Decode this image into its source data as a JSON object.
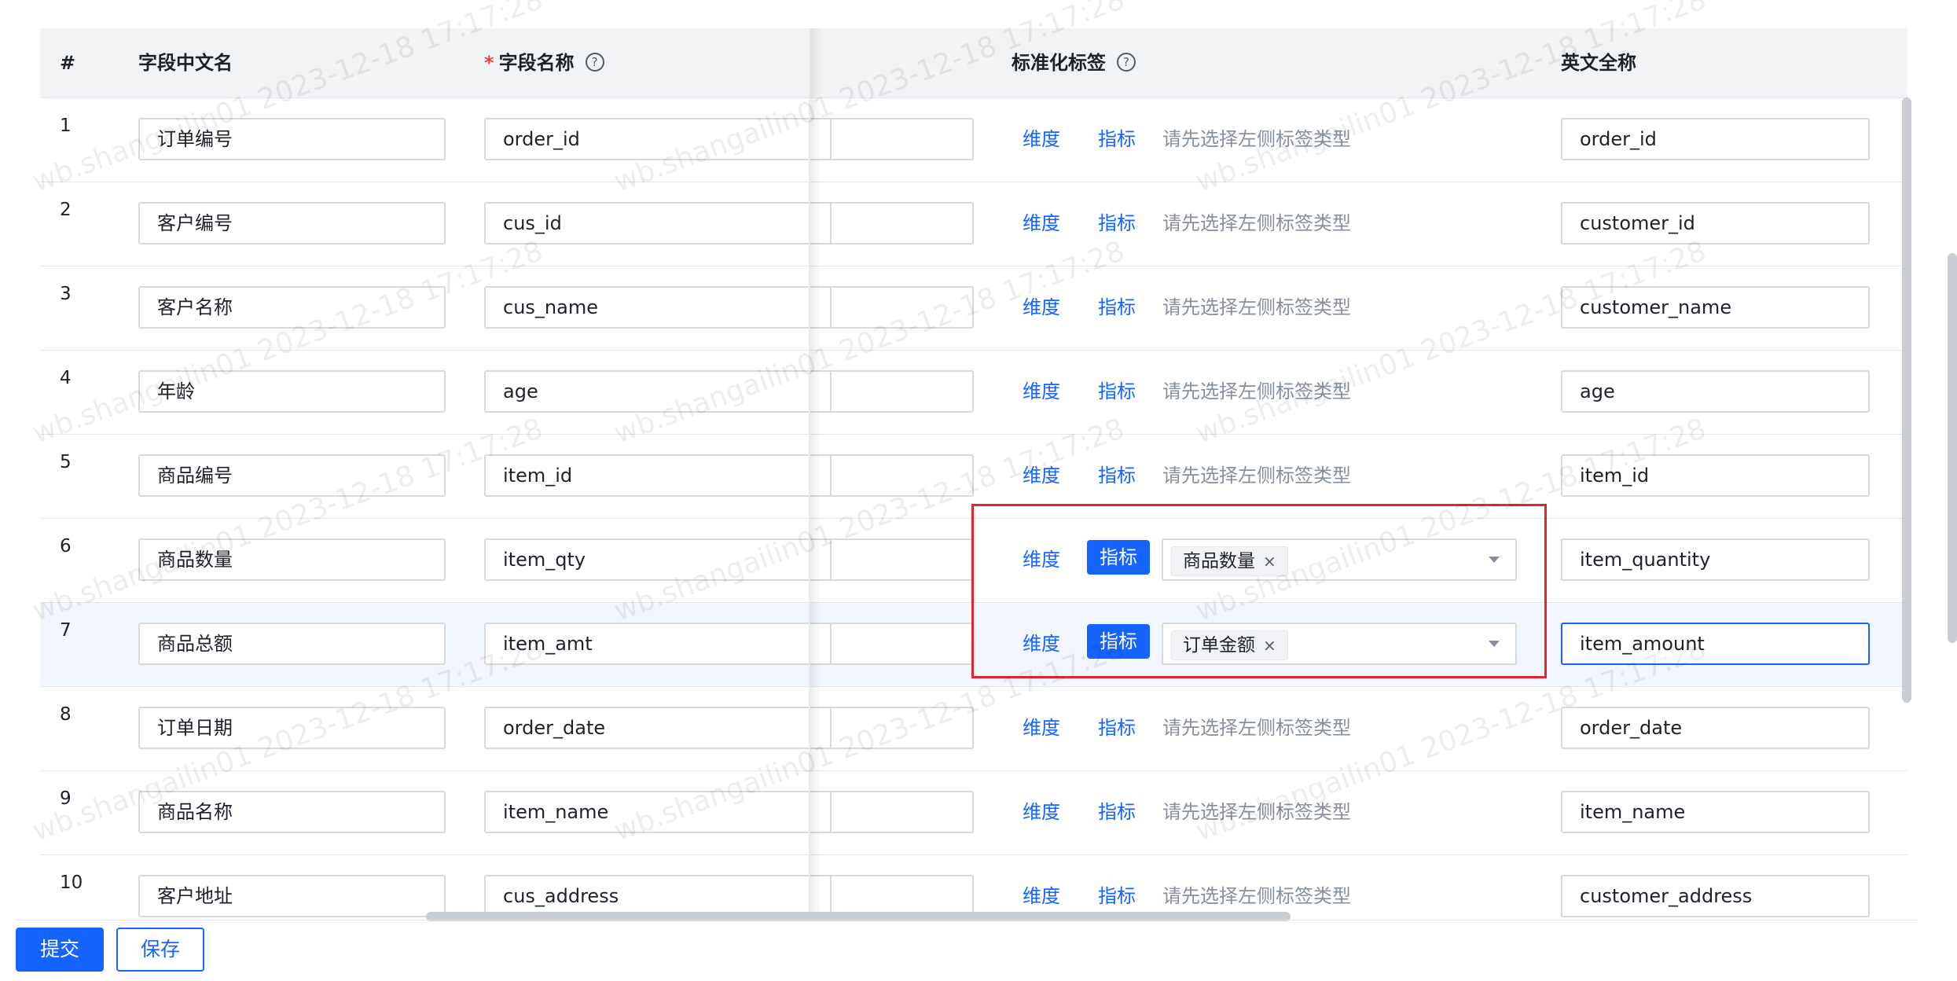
{
  "headers": {
    "num": "#",
    "cn_name": "字段中文名",
    "required_mark": "*",
    "field_name": "字段名称",
    "std_tag": "标准化标签",
    "en_full": "英文全称",
    "help_glyph": "?"
  },
  "tag_buttons": {
    "dimension": "维度",
    "indicator": "指标"
  },
  "tag_placeholder": "请先选择左侧标签类型",
  "rows": [
    {
      "num": "1",
      "cn": "订单编号",
      "en": "order_id",
      "full": "order_id"
    },
    {
      "num": "2",
      "cn": "客户编号",
      "en": "cus_id",
      "full": "customer_id"
    },
    {
      "num": "3",
      "cn": "客户名称",
      "en": "cus_name",
      "full": "customer_name"
    },
    {
      "num": "4",
      "cn": "年龄",
      "en": "age",
      "full": "age"
    },
    {
      "num": "5",
      "cn": "商品编号",
      "en": "item_id",
      "full": "item_id"
    },
    {
      "num": "6",
      "cn": "商品数量",
      "en": "item_qty",
      "full": "item_quantity",
      "tag": "商品数量"
    },
    {
      "num": "7",
      "cn": "商品总额",
      "en": "item_amt",
      "full": "item_amount",
      "tag": "订单金额"
    },
    {
      "num": "8",
      "cn": "订单日期",
      "en": "order_date",
      "full": "order_date"
    },
    {
      "num": "9",
      "cn": "商品名称",
      "en": "item_name",
      "full": "item_name"
    },
    {
      "num": "10",
      "cn": "客户地址",
      "en": "cus_address",
      "full": "customer_address"
    }
  ],
  "chip_close": "×",
  "footer": {
    "submit": "提交",
    "save": "保存"
  },
  "watermark": "wb.shangailin01 2023-12-18 17:17:28",
  "colors": {
    "primary": "#1664ff",
    "highlight_box": "#e5252a",
    "required": "#f53f3f"
  }
}
